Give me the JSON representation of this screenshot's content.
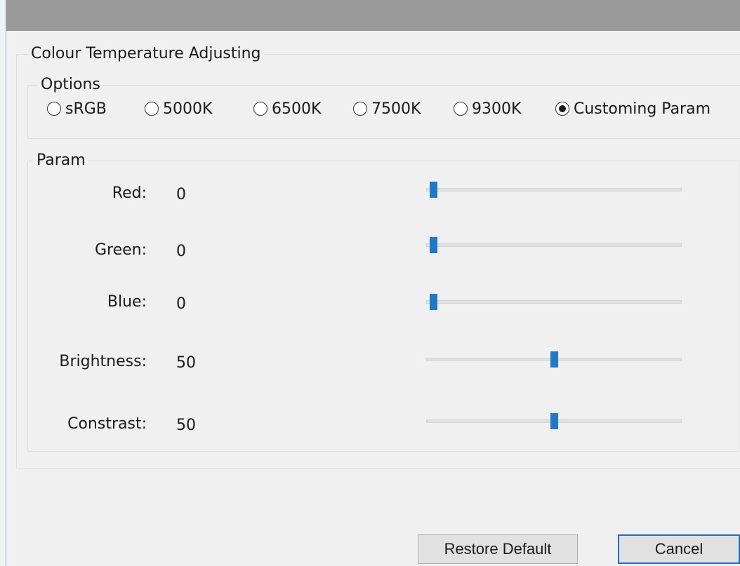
{
  "window": {
    "title": ""
  },
  "group": {
    "label": "Colour Temperature Adjusting"
  },
  "options": {
    "label": "Options",
    "items": [
      {
        "label": "sRGB",
        "checked": false
      },
      {
        "label": "5000K",
        "checked": false
      },
      {
        "label": "6500K",
        "checked": false
      },
      {
        "label": "7500K",
        "checked": false
      },
      {
        "label": "9300K",
        "checked": false
      },
      {
        "label": "Customing Param",
        "checked": true
      }
    ]
  },
  "param": {
    "label": "Param",
    "rows": [
      {
        "label": "Red:",
        "value": "0",
        "slider_fraction": 0.0
      },
      {
        "label": "Green:",
        "value": "0",
        "slider_fraction": 0.0
      },
      {
        "label": "Blue:",
        "value": "0",
        "slider_fraction": 0.0
      },
      {
        "label": "Brightness:",
        "value": "50",
        "slider_fraction": 0.5
      },
      {
        "label": "Constrast:",
        "value": "50",
        "slider_fraction": 0.5
      }
    ]
  },
  "buttons": {
    "restore_label": "Restore Default",
    "cancel_label": "Cancel"
  },
  "colors": {
    "accent": "#1f78c8",
    "titlebar": "#9a9a9a",
    "dialog_bg": "#f0f0f0"
  }
}
